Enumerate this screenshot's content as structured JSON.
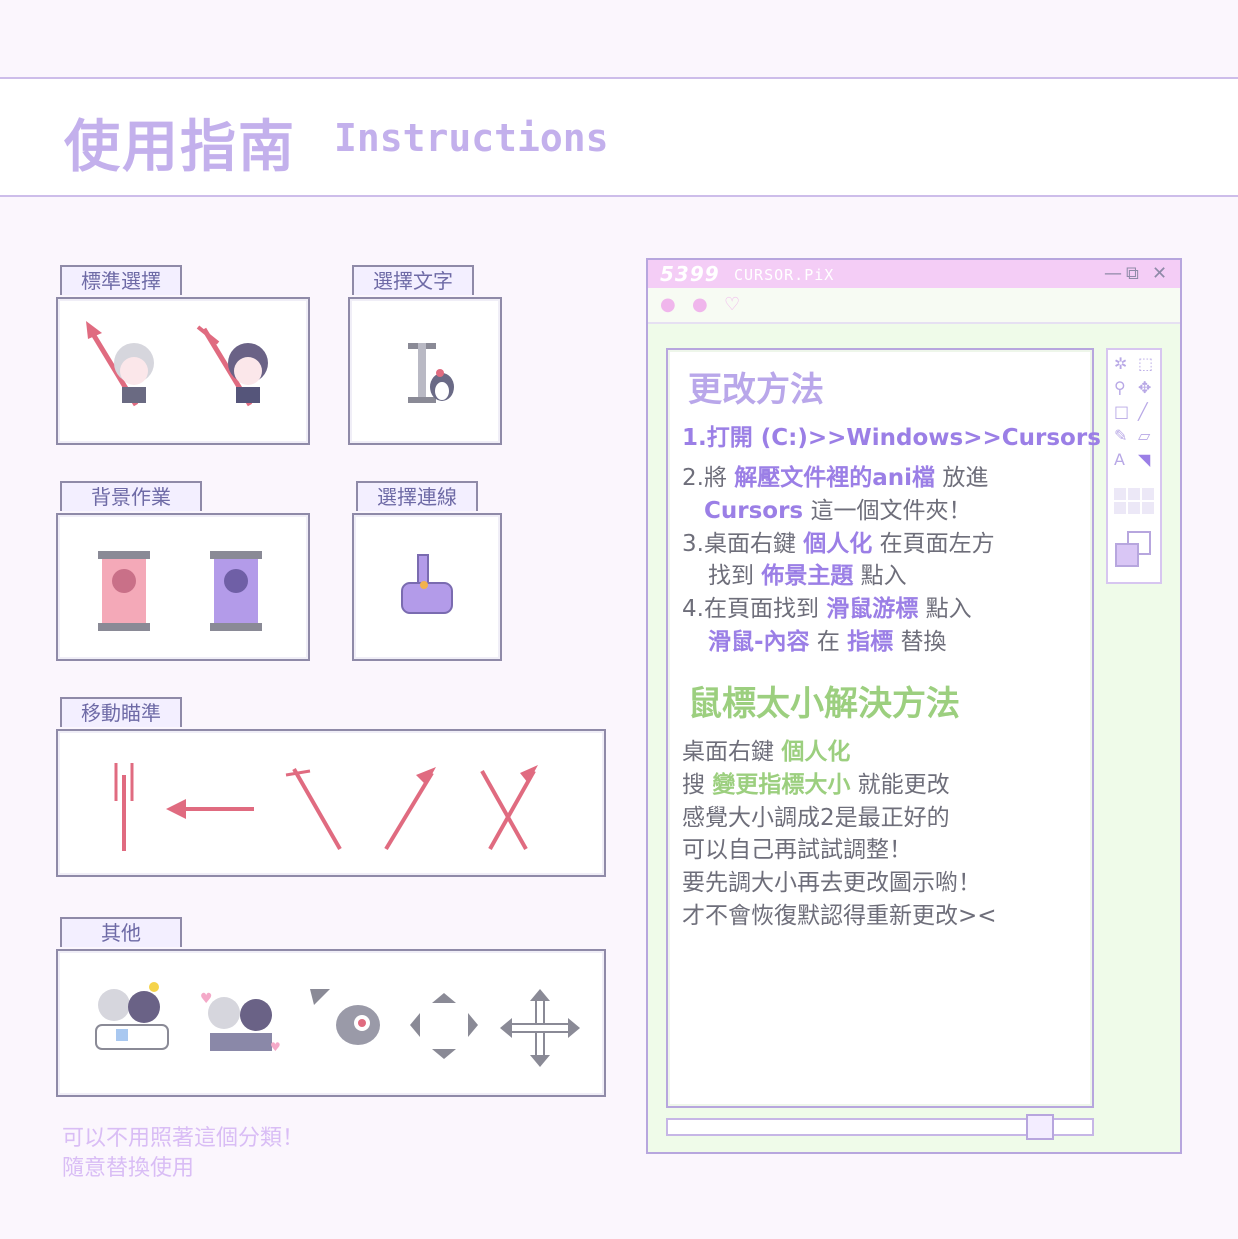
{
  "header": {
    "title_cn": "使用指南",
    "title_en": "Instructions"
  },
  "sections": {
    "normal": "標準選擇",
    "text": "選擇文字",
    "background": "背景作業",
    "link": "選擇連線",
    "move": "移動瞄準",
    "other": "其他"
  },
  "footnote": {
    "line1": "可以不用照著這個分類！",
    "line2": "隨意替換使用"
  },
  "window": {
    "brand": "5399",
    "title": "CURSOR.PiX",
    "controls": {
      "minimize": "—",
      "restore": "⧉",
      "close": "✕"
    },
    "colors": {
      "purple": "#9b7fe6",
      "green": "#9ccf7f"
    },
    "howto": {
      "heading": "更改方法",
      "s1": "1.打開 (C:)>>Windows>>Cursors",
      "s2a": "2.將",
      "s2b": "解壓文件裡的ani檔",
      "s2c": "放進",
      "s2d": "Cursors",
      "s2e": "這一個文件夾！",
      "s3a": "3.桌面右鍵",
      "s3b": "個人化",
      "s3c": "在頁面左方",
      "s3d": "找到",
      "s3e": "佈景主題",
      "s3f": "點入",
      "s4a": "4.在頁面找到",
      "s4b": "滑鼠游標",
      "s4c": "點入",
      "s4d": "滑鼠-內容",
      "s4e": "在",
      "s4f": "指標",
      "s4g": "替換"
    },
    "size": {
      "heading": "鼠標太小解決方法",
      "l1a": "桌面右鍵",
      "l1b": "個人化",
      "l2a": "搜",
      "l2b": "變更指標大小",
      "l2c": "就能更改",
      "l3": "感覺大小調成2是最正好的",
      "l4": "可以自己再試試調整！",
      "l5": "要先調大小再去更改圖示喲！",
      "l6": "才不會恢復默認得重新更改><"
    },
    "slider_value": 0.83
  }
}
